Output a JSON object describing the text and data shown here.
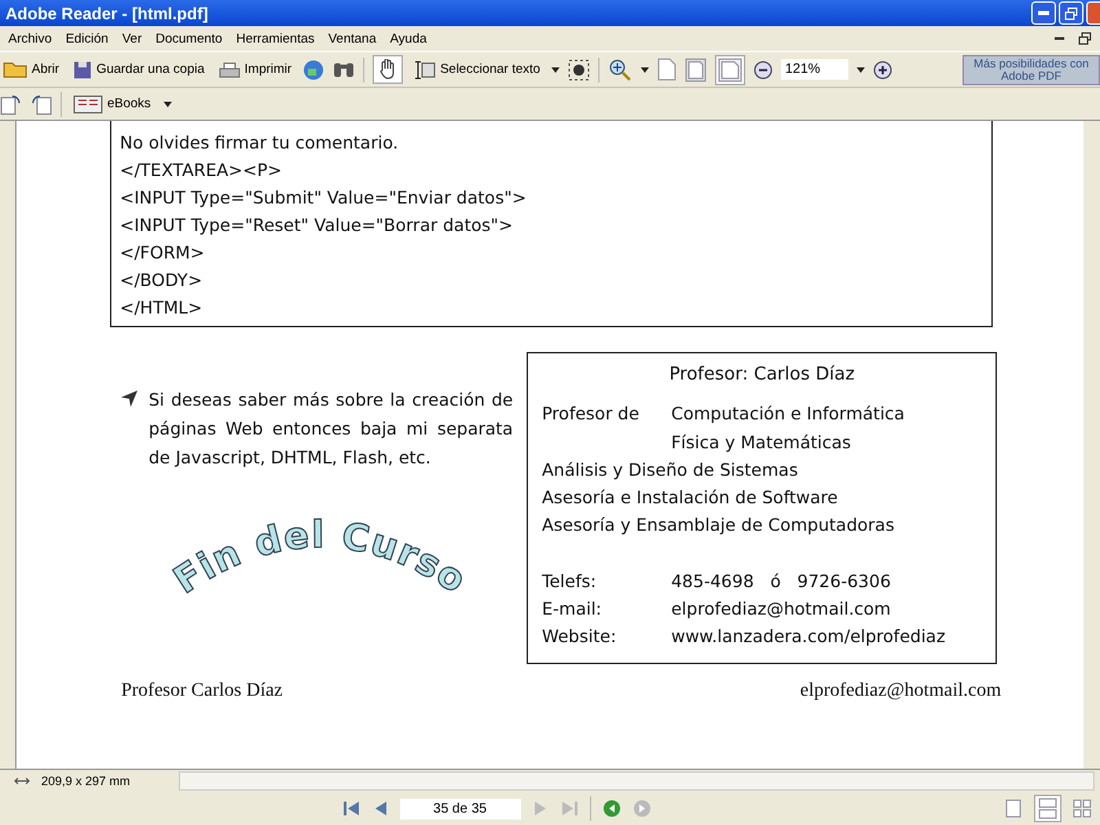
{
  "window": {
    "title": "Adobe Reader - [html.pdf]"
  },
  "menu": [
    "Archivo",
    "Edición",
    "Ver",
    "Documento",
    "Herramientas",
    "Ventana",
    "Ayuda"
  ],
  "toolbar": {
    "open": "Abrir",
    "save": "Guardar una copia",
    "print": "Imprimir",
    "select_text": "Seleccionar texto",
    "zoom": "121%",
    "promo": "Más posibilidades con Adobe PDF",
    "ebooks": "eBooks"
  },
  "document": {
    "code_lines": [
      "No olvides firmar tu comentario.",
      "</TEXTAREA><P>",
      "<INPUT Type=\"Submit\" Value=\"Enviar datos\">",
      "<INPUT Type=\"Reset\" Value=\"Borrar datos\">",
      "</FORM>",
      "</BODY>",
      "</HTML>"
    ],
    "bullet": "Si deseas saber más sobre la creación de páginas Web entonces baja mi separata de Javascript, DHTML, Flash, etc.",
    "card": {
      "title": "Profesor: Carlos Díaz",
      "rows": [
        {
          "label": "Profesor de",
          "value": "Computación e Informática"
        },
        {
          "label": "",
          "value": "Física y Matemáticas"
        }
      ],
      "lines": [
        "Análisis y Diseño de Sistemas",
        "Asesoría e Instalación de Software",
        "Asesoría y Ensamblaje de Computadoras"
      ],
      "contacts": [
        {
          "label": "Telefs:",
          "value": "485-4698   ó   9726-6306"
        },
        {
          "label": "E-mail:",
          "value": "elprofediaz@hotmail.com"
        },
        {
          "label": "Website:",
          "value": "www.lanzadera.com/elprofediaz"
        }
      ]
    },
    "wordart": "Fin del Curso",
    "footer_left": "Profesor Carlos Díaz",
    "footer_right": "elprofediaz@hotmail.com"
  },
  "status": {
    "page_size": "209,9 x 297 mm",
    "page": "35 de 35"
  }
}
